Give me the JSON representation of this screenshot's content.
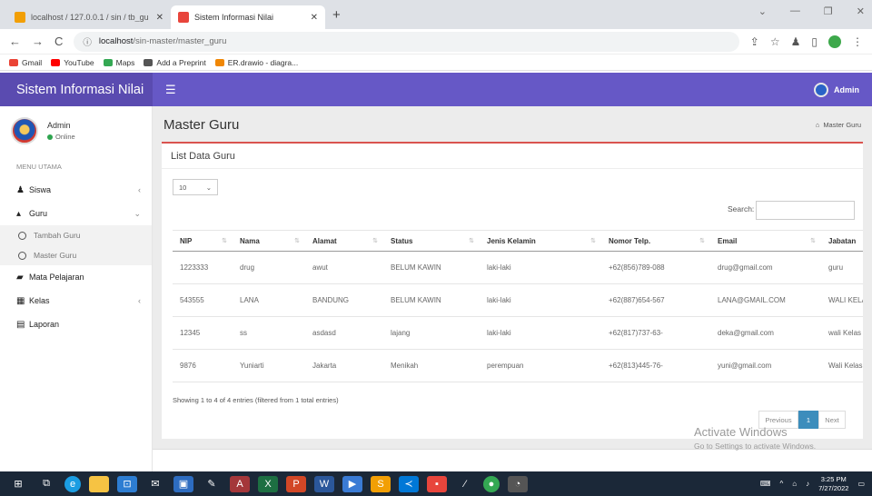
{
  "browser": {
    "tabs": [
      {
        "title": "localhost / 127.0.0.1 / sin / tb_gu",
        "favicon_color": "#f29f05",
        "active": false
      },
      {
        "title": "Sistem Informasi Nilai",
        "favicon_color": "#e8453c",
        "active": true
      }
    ],
    "address": {
      "host": "localhost",
      "path": "/sin-master/master_guru"
    },
    "bookmarks": [
      {
        "label": "Gmail",
        "icon": "gmail-icon",
        "color": "#ea4335"
      },
      {
        "label": "YouTube",
        "icon": "youtube-icon",
        "color": "#ff0000"
      },
      {
        "label": "Maps",
        "icon": "maps-icon",
        "color": "#34a853"
      },
      {
        "label": "Add a Preprint",
        "icon": "preprint-icon",
        "color": "#555555"
      },
      {
        "label": "ER.drawio - diagra...",
        "icon": "drawio-icon",
        "color": "#f08705"
      }
    ]
  },
  "app": {
    "brand": "Sistem Informasi Nilai",
    "top_user": "Admin",
    "accent": "#6658c6",
    "brand_bg": "#5a4bb0"
  },
  "sidebar": {
    "user_name": "Admin",
    "user_status": "Online",
    "menu_header": "MENU UTAMA",
    "items": [
      {
        "label": "Siswa",
        "icon": "user-icon",
        "chevron": "‹"
      },
      {
        "label": "Guru",
        "icon": "graduation-cap-icon",
        "chevron": "⌄"
      },
      {
        "label": "Mata Pelajaran",
        "icon": "book-icon",
        "chevron": ""
      },
      {
        "label": "Kelas",
        "icon": "building-icon",
        "chevron": "‹"
      },
      {
        "label": "Laporan",
        "icon": "report-icon",
        "chevron": ""
      }
    ],
    "guru_sub": [
      "Tambah Guru",
      "Master Guru"
    ]
  },
  "page": {
    "title": "Master Guru",
    "breadcrumb": "Master Guru",
    "box_title": "List Data Guru",
    "length_value": "10",
    "search_label": "Search:",
    "search_value": "",
    "columns": [
      "NIP",
      "Nama",
      "Alamat",
      "Status",
      "Jenis Kelamin",
      "Nomor Telp.",
      "Email",
      "Jabatan"
    ],
    "rows": [
      [
        "1223333",
        "drug",
        "awut",
        "BELUM KAWIN",
        "laki-laki",
        "+62(856)789-088",
        "drug@gmail.com",
        "guru"
      ],
      [
        "543555",
        "LANA",
        "BANDUNG",
        "BELUM KAWIN",
        "laki-laki",
        "+62(887)654-567",
        "LANA@GMAIL.COM",
        "WALI KELAS"
      ],
      [
        "12345",
        "ss",
        "asdasd",
        "lajang",
        "laki-laki",
        "+62(817)737-63-",
        "deka@gmail.com",
        "wali Kelas"
      ],
      [
        "9876",
        "Yuniarti",
        "Jakarta",
        "Menikah",
        "perempuan",
        "+62(813)445-76-",
        "yuni@gmail.com",
        "Wali Kelas"
      ]
    ],
    "info": "Showing 1 to 4 of 4 entries (filtered from 1 total entries)",
    "pager": {
      "prev": "Previous",
      "current": "1",
      "next": "Next"
    }
  },
  "watermark": {
    "line1": "Activate Windows",
    "line2": "Go to Settings to activate Windows."
  },
  "taskbar": {
    "time": "3:25 PM",
    "date": "7/27/2022",
    "apps": [
      {
        "icon": "windows-start-icon",
        "color": "#1b2838"
      },
      {
        "icon": "task-view-icon",
        "color": "#1b2838"
      },
      {
        "icon": "edge-icon",
        "color": "#1b9de2"
      },
      {
        "icon": "file-explorer-icon",
        "color": "#f6c343"
      },
      {
        "icon": "store-icon",
        "color": "#2d7dd2"
      },
      {
        "icon": "mail-icon",
        "color": "#1b2838"
      },
      {
        "icon": "photos-icon",
        "color": "#2d6cc0"
      },
      {
        "icon": "paint-icon",
        "color": "#1b2838"
      },
      {
        "icon": "access-icon",
        "color": "#a4373a"
      },
      {
        "icon": "excel-icon",
        "color": "#1d6f42"
      },
      {
        "icon": "powerpoint-icon",
        "color": "#d24726"
      },
      {
        "icon": "word-icon",
        "color": "#2b579a"
      },
      {
        "icon": "media-icon",
        "color": "#3a7bd5"
      },
      {
        "icon": "sublime-icon",
        "color": "#f29f05"
      },
      {
        "icon": "vscode-icon",
        "color": "#0078d7"
      },
      {
        "icon": "app-icon",
        "color": "#e8453c"
      },
      {
        "icon": "pen-icon",
        "color": "#1b2838"
      },
      {
        "icon": "chrome-icon",
        "color": "#34a853"
      },
      {
        "icon": "app2-icon",
        "color": "#555555"
      }
    ]
  }
}
